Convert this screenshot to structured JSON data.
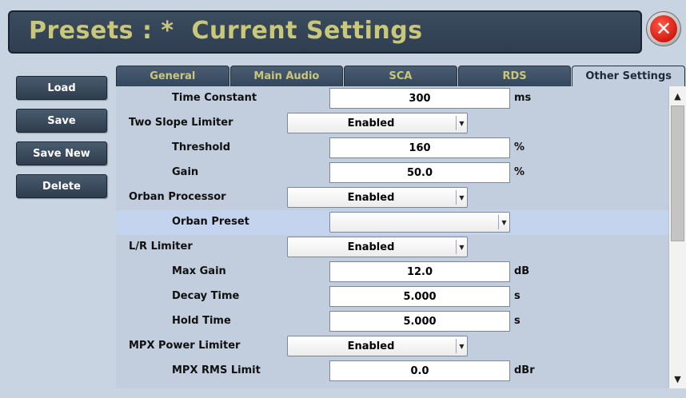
{
  "header": {
    "title": "Presets : *  Current Settings",
    "close_icon_glyph": "✕"
  },
  "side_buttons": {
    "load": "Load",
    "save": "Save",
    "save_new": "Save New",
    "delete": "Delete"
  },
  "tabs": [
    {
      "label": "General"
    },
    {
      "label": "Main Audio"
    },
    {
      "label": "SCA"
    },
    {
      "label": "RDS"
    },
    {
      "label": "Other Settings",
      "active": true
    }
  ],
  "settings": {
    "time_constant": {
      "label": "Time Constant",
      "value": "300",
      "unit": "ms"
    },
    "two_slope_limiter": {
      "label": "Two Slope Limiter",
      "value": "Enabled"
    },
    "threshold": {
      "label": "Threshold",
      "value": "160",
      "unit": "%"
    },
    "gain": {
      "label": "Gain",
      "value": "50.0",
      "unit": "%"
    },
    "orban_processor": {
      "label": "Orban Processor",
      "value": "Enabled"
    },
    "orban_preset": {
      "label": "Orban Preset",
      "value": ""
    },
    "lr_limiter": {
      "label": "L/R Limiter",
      "value": "Enabled"
    },
    "max_gain": {
      "label": "Max Gain",
      "value": "12.0",
      "unit": "dB"
    },
    "decay_time": {
      "label": "Decay Time",
      "value": "5.000",
      "unit": "s"
    },
    "hold_time": {
      "label": "Hold Time",
      "value": "5.000",
      "unit": "s"
    },
    "mpx_power_limiter": {
      "label": "MPX Power Limiter",
      "value": "Enabled"
    },
    "mpx_rms_limit": {
      "label": "MPX RMS Limit",
      "value": "0.0",
      "unit": "dBr"
    }
  },
  "scrollbar": {
    "up_glyph": "▲",
    "down_glyph": "▼"
  },
  "colors": {
    "background": "#c8d4e2",
    "header_bg": "#34465a",
    "title_text": "#c9c77a",
    "tab_text": "#c9c77a",
    "highlight_row": "#c4d4ee",
    "close_red": "#d41a10"
  }
}
